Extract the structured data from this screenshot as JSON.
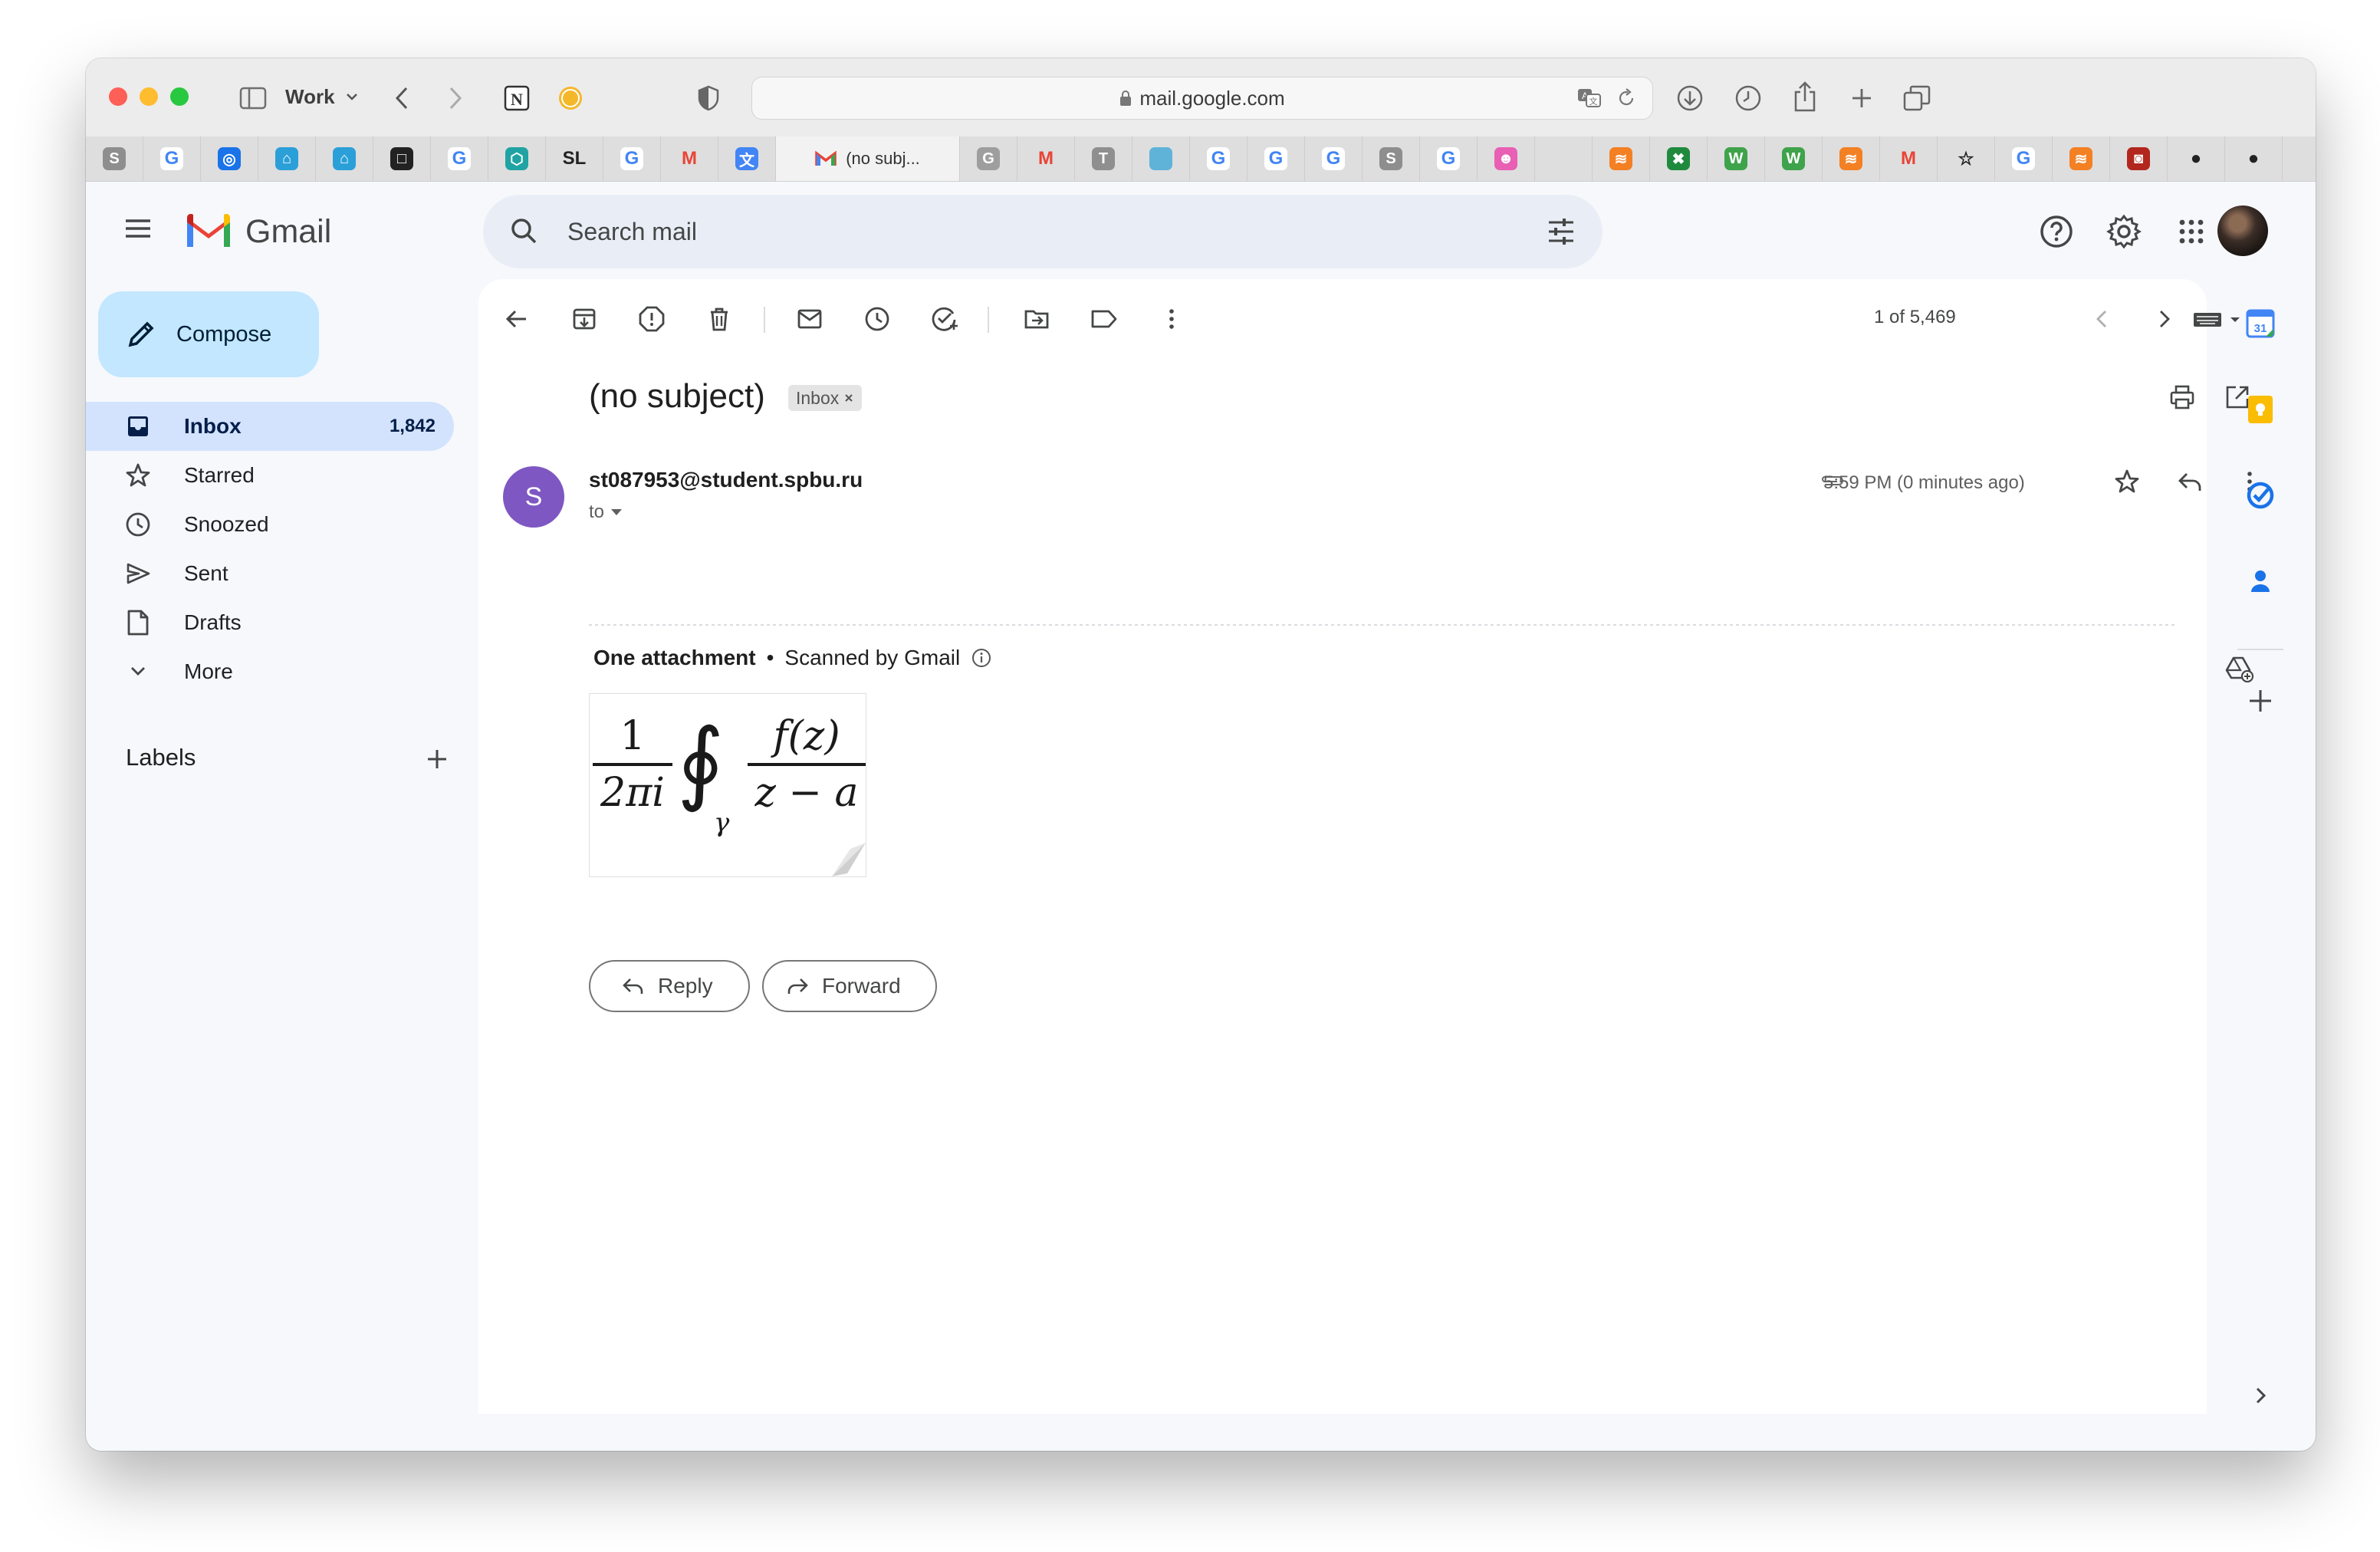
{
  "browser": {
    "workspace_label": "Work",
    "url": "mail.google.com",
    "active_tab_title": "(no subj...",
    "pinned_tabs": [
      {
        "glyph": "S",
        "bg": "#8e8e8e",
        "name": "s-tab-icon"
      },
      {
        "glyph": "G",
        "bg": "google",
        "name": "google-tab-icon"
      },
      {
        "glyph": "◎",
        "bg": "#1a73e8",
        "name": "circle-tab-icon"
      },
      {
        "glyph": "⌂",
        "bg": "#2b9fd8",
        "name": "house-tab-icon"
      },
      {
        "glyph": "⌂",
        "bg": "#2b9fd8",
        "name": "house-tab-icon"
      },
      {
        "glyph": "□",
        "bg": "#222222",
        "name": "square-tab-icon"
      },
      {
        "glyph": "G",
        "bg": "google",
        "name": "google-tab-icon"
      },
      {
        "glyph": "⬡",
        "bg": "#20a3a3",
        "name": "hexagon-tab-icon"
      },
      {
        "glyph": "SL",
        "bg": "text",
        "name": "sl-tab-icon"
      },
      {
        "glyph": "G",
        "bg": "google",
        "name": "google-tab-icon"
      },
      {
        "glyph": "M",
        "bg": "gmail",
        "name": "gmail-tab-icon"
      },
      {
        "glyph": "文",
        "bg": "#4285f4",
        "name": "translate-tab-icon"
      }
    ],
    "right_tabs": [
      {
        "glyph": "G",
        "bg": "#9e9e9e",
        "name": "g-gray-tab-icon"
      },
      {
        "glyph": "M",
        "bg": "gmail",
        "name": "gmail-tab-icon"
      },
      {
        "glyph": "T",
        "bg": "#8f8f8f",
        "name": "t-tab-icon"
      },
      {
        "glyph": "",
        "bg": "#5fb3d9",
        "name": "blue-square-tab-icon"
      },
      {
        "glyph": "G",
        "bg": "google",
        "name": "google-tab-icon"
      },
      {
        "glyph": "G",
        "bg": "google",
        "name": "google-tab-icon"
      },
      {
        "glyph": "G",
        "bg": "google",
        "name": "google-tab-icon"
      },
      {
        "glyph": "S",
        "bg": "#8e8e8e",
        "name": "s-tab-icon"
      },
      {
        "glyph": "G",
        "bg": "google",
        "name": "google-tab-icon"
      },
      {
        "glyph": "☻",
        "bg": "#e85fb4",
        "name": "smiley-tab-icon"
      },
      {
        "glyph": "",
        "bg": "text",
        "name": "apple-tab-icon"
      },
      {
        "glyph": "≋",
        "bg": "#f48024",
        "name": "stack-tab-icon"
      },
      {
        "glyph": "✖",
        "bg": "#1f8a3d",
        "name": "excel-tab-icon"
      },
      {
        "glyph": "W",
        "bg": "#3ea34a",
        "name": "w-tab-icon"
      },
      {
        "glyph": "W",
        "bg": "#3ea34a",
        "name": "w-tab-icon"
      },
      {
        "glyph": "≋",
        "bg": "#f48024",
        "name": "stack-tab-icon"
      },
      {
        "glyph": "M",
        "bg": "gmail",
        "name": "gmail-tab-icon"
      },
      {
        "glyph": "☆",
        "bg": "text",
        "name": "star-tab-icon"
      },
      {
        "glyph": "G",
        "bg": "google",
        "name": "google-tab-icon"
      },
      {
        "glyph": "≋",
        "bg": "#f48024",
        "name": "stack-tab-icon"
      },
      {
        "glyph": "◙",
        "bg": "#b3261e",
        "name": "red-tab-icon"
      },
      {
        "glyph": "●",
        "bg": "text",
        "name": "github-tab-icon"
      },
      {
        "glyph": "●",
        "bg": "text",
        "name": "github-tab-icon"
      }
    ]
  },
  "gmail": {
    "product_name": "Gmail",
    "search_placeholder": "Search mail",
    "compose_label": "Compose",
    "nav": [
      {
        "label": "Inbox",
        "count": "1,842",
        "icon": "inbox-icon"
      },
      {
        "label": "Starred",
        "count": "",
        "icon": "star-icon"
      },
      {
        "label": "Snoozed",
        "count": "",
        "icon": "clock-icon"
      },
      {
        "label": "Sent",
        "count": "",
        "icon": "send-icon"
      },
      {
        "label": "Drafts",
        "count": "",
        "icon": "draft-icon"
      },
      {
        "label": "More",
        "count": "",
        "icon": "chevron-down-icon"
      }
    ],
    "labels_title": "Labels",
    "pager": "1 of 5,469",
    "message": {
      "subject": "(no subject)",
      "label_chip": "Inbox",
      "sender_initial": "S",
      "sender": "st087953@student.spbu.ru",
      "to": "to",
      "timestamp": "5:59 PM (0 minutes ago)",
      "attachment_title": "One attachment",
      "scanned": "Scanned by Gmail",
      "formula": {
        "numerator_left": "1",
        "denominator_left": "2πi",
        "integral": "∮",
        "subscript": "γ",
        "numerator_right": "f(z)",
        "denominator_right": "z − a"
      }
    },
    "reply_label": "Reply",
    "forward_label": "Forward"
  },
  "colors": {
    "accent": "#0b57d0",
    "compose_bg": "#c2e7ff",
    "active_nav": "#d3e3fd",
    "avatar": "#7e57c2"
  }
}
